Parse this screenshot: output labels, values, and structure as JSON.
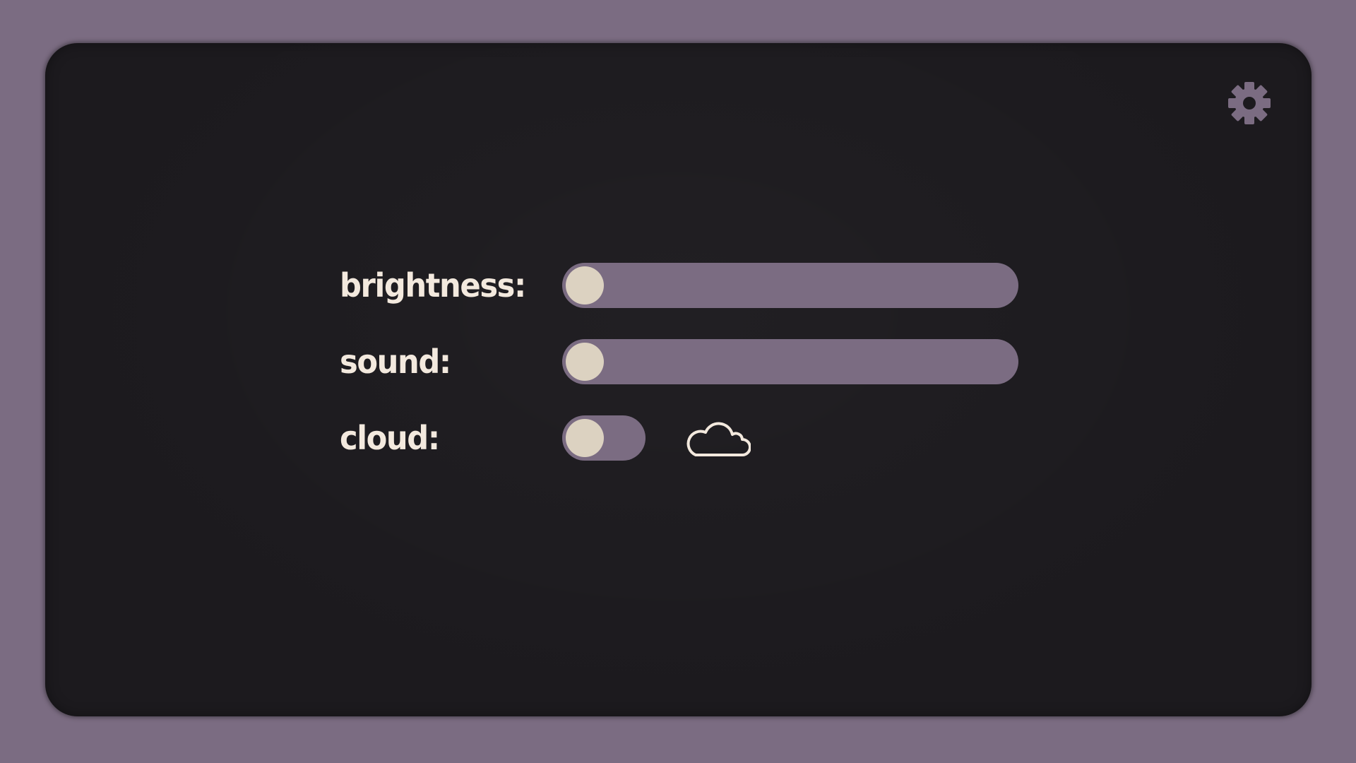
{
  "settings": {
    "brightness": {
      "label": "brightness:",
      "value": 0
    },
    "sound": {
      "label": "sound:",
      "value": 0
    },
    "cloud": {
      "label": "cloud:",
      "enabled": false
    }
  },
  "icons": {
    "settings": "gear-icon",
    "cloud": "cloud-icon"
  },
  "colors": {
    "background": "#7b6c82",
    "panel": "#1c1a1e",
    "text": "#f3e9de",
    "track": "#7b6c82",
    "knob": "#dcd2c1"
  }
}
